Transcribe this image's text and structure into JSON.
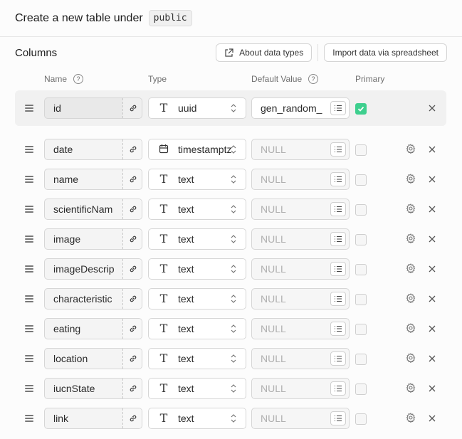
{
  "header": {
    "title": "Create a new table under",
    "schema": "public"
  },
  "columns_section": {
    "title": "Columns",
    "about_button": "About data types",
    "import_button": "Import data via spreadsheet"
  },
  "column_headers": {
    "name": "Name",
    "type": "Type",
    "default": "Default Value",
    "primary": "Primary",
    "help_glyph": "?"
  },
  "rows": [
    {
      "name": "id",
      "type_icon": "T",
      "type": "uuid",
      "default": "gen_random_",
      "default_is_placeholder": false,
      "primary": true
    },
    {
      "name": "date",
      "type_icon": "calendar",
      "type": "timestamptz",
      "default": "NULL",
      "default_is_placeholder": true,
      "primary": false
    },
    {
      "name": "name",
      "type_icon": "T",
      "type": "text",
      "default": "NULL",
      "default_is_placeholder": true,
      "primary": false
    },
    {
      "name": "scientificNam",
      "type_icon": "T",
      "type": "text",
      "default": "NULL",
      "default_is_placeholder": true,
      "primary": false
    },
    {
      "name": "image",
      "type_icon": "T",
      "type": "text",
      "default": "NULL",
      "default_is_placeholder": true,
      "primary": false
    },
    {
      "name": "imageDescrip",
      "type_icon": "T",
      "type": "text",
      "default": "NULL",
      "default_is_placeholder": true,
      "primary": false
    },
    {
      "name": "characteristic",
      "type_icon": "T",
      "type": "text",
      "default": "NULL",
      "default_is_placeholder": true,
      "primary": false
    },
    {
      "name": "eating",
      "type_icon": "T",
      "type": "text",
      "default": "NULL",
      "default_is_placeholder": true,
      "primary": false
    },
    {
      "name": "location",
      "type_icon": "T",
      "type": "text",
      "default": "NULL",
      "default_is_placeholder": true,
      "primary": false
    },
    {
      "name": "iucnState",
      "type_icon": "T",
      "type": "text",
      "default": "NULL",
      "default_is_placeholder": true,
      "primary": false
    },
    {
      "name": "link",
      "type_icon": "T",
      "type": "text",
      "default": "NULL",
      "default_is_placeholder": true,
      "primary": false
    }
  ],
  "colors": {
    "accent": "#3ecf8e",
    "placeholder": "#b0b0b0"
  }
}
